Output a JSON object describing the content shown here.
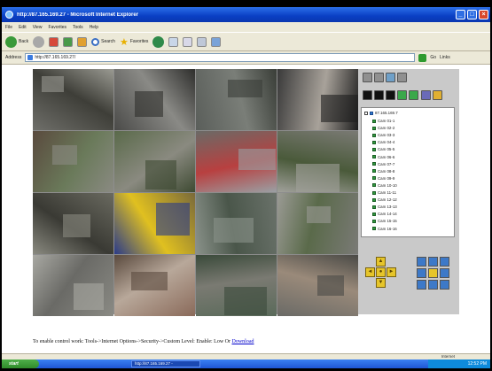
{
  "window": {
    "title": "http://87.165.169.27 - Microsoft Internet Explorer",
    "controls": {
      "minimize": "_",
      "maximize": "□",
      "close": "×"
    }
  },
  "menubar": {
    "items": [
      "File",
      "Edit",
      "View",
      "Favorites",
      "Tools",
      "Help"
    ]
  },
  "toolbar": {
    "back": "Back",
    "search": "Search",
    "favorites": "Favorites",
    "icons": [
      "back-arrow-icon",
      "forward-arrow-icon",
      "stop-icon",
      "refresh-icon",
      "home-icon",
      "search-icon",
      "favorites-star-icon",
      "media-icon",
      "history-icon",
      "mail-icon",
      "print-icon",
      "edit-icon"
    ]
  },
  "addressbar": {
    "label": "Address",
    "url": "http://87.165.169.27/",
    "go": "Go",
    "links": "Links"
  },
  "cameras": {
    "root": "87.165.169.7",
    "items": [
      "Cam 01-1",
      "Cam 02-2",
      "Cam 03-3",
      "Cam 04-4",
      "Cam 05-5",
      "Cam 06-6",
      "Cam 07-7",
      "Cam 08-8",
      "Cam 09-9",
      "Cam 10-10",
      "Cam 11-11",
      "Cam 12-12",
      "Cam 13-13",
      "Cam 14-14",
      "Cam 15-15",
      "Cam 16-16"
    ]
  },
  "ptz": {
    "up": "▲",
    "down": "▼",
    "left": "◄",
    "right": "►",
    "center": "●"
  },
  "footer": {
    "text": "To enable control work: Tools->Internet Options->Security->Custom Level: Enable: Low Or",
    "link": "Download"
  },
  "statusbar": {
    "zone": "Internet"
  },
  "taskbar": {
    "start": "start",
    "task": "http://87.165.169.27 -",
    "clock": "12:52 PM"
  }
}
